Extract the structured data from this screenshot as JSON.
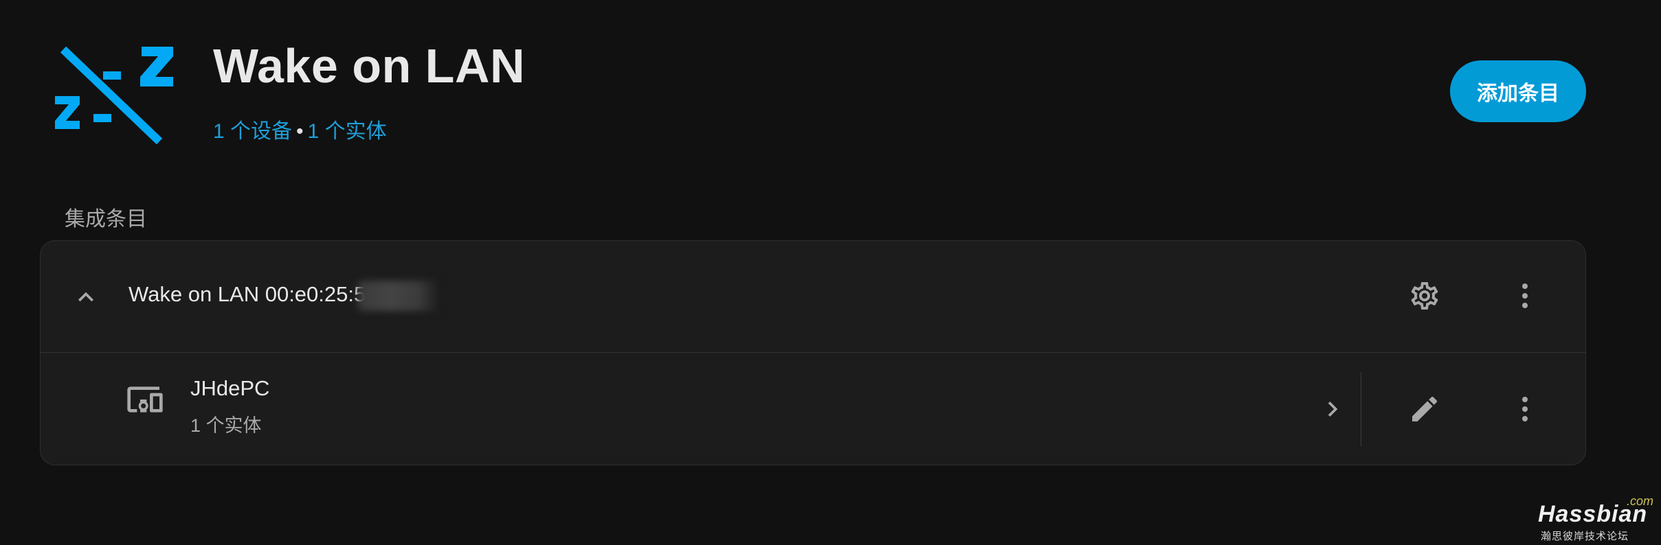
{
  "header": {
    "title": "Wake on LAN",
    "devices_link": "1 个设备",
    "separator": "•",
    "entities_link": "1 个实体",
    "add_entry_label": "添加条目"
  },
  "section": {
    "label": "集成条目"
  },
  "entry": {
    "title": "Wake on LAN 00:e0:25:5"
  },
  "device": {
    "name": "JHdePC",
    "sub": "1 个实体"
  },
  "watermark": {
    "com": ".com",
    "main": "Hassbian",
    "sub": "瀚思彼岸技术论坛"
  },
  "colors": {
    "background": "#111111",
    "card": "#1c1c1c",
    "accent": "#039bd6",
    "link": "#1e9fd8",
    "logo": "#03a9f4"
  },
  "icons": {
    "logo": "wake-on-lan-zzz-logo",
    "collapse": "chevron-up-icon",
    "settings": "gear-icon",
    "menu": "kebab-menu-icon",
    "device": "devices-icon",
    "navigate": "chevron-right-icon",
    "edit": "pencil-icon"
  }
}
